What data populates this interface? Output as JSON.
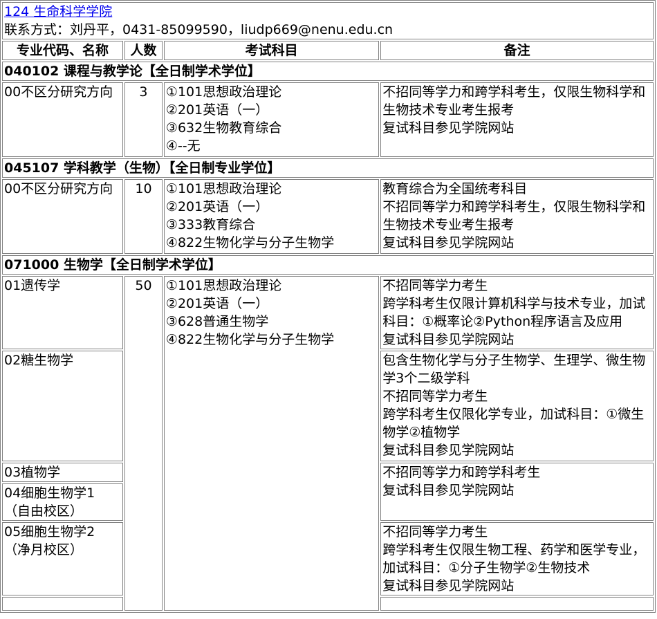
{
  "header": {
    "school_link": "124 生命科学学院",
    "contact": "联系方式：刘丹平，0431-85099590，liudp669@nenu.edu.cn"
  },
  "columns": [
    "专业代码、名称",
    "人数",
    "考试科目",
    "备注"
  ],
  "majors": [
    {
      "title": "040102 课程与教学论【全日制学术学位】",
      "direction": "00不区分研究方向",
      "count": "3",
      "subjects": [
        "①101思想政治理论",
        "②201英语（一）",
        "③632生物教育综合",
        "④--无"
      ],
      "notes": [
        "不招同等学力和跨学科考生，仅限生物科学和生物技术专业考生报考",
        "复试科目参见学院网站"
      ]
    },
    {
      "title": "045107 学科教学（生物）【全日制专业学位】",
      "direction": "00不区分研究方向",
      "count": "10",
      "subjects": [
        "①101思想政治理论",
        "②201英语（一）",
        "③333教育综合",
        "④822生物化学与分子生物学"
      ],
      "notes": [
        "教育综合为全国统考科目",
        "不招同等学力和跨学科考生，仅限生物科学和生物技术专业考生报考",
        "复试科目参见学院网站"
      ]
    },
    {
      "title": "071000 生物学【全日制学术学位】",
      "count": "50",
      "subjects": [
        "①101思想政治理论",
        "②201英语（一）",
        "③628普通生物学",
        "④822生物化学与分子生物学"
      ],
      "directions": [
        {
          "name": "01遗传学",
          "notes": [
            "不招同等学力考生",
            "跨学科考生仅限计算机科学与技术专业，加试科目：①概率论②Python程序语言及应用",
            "复试科目参见学院网站"
          ]
        },
        {
          "name": "02糖生物学",
          "notes": [
            "包含生物化学与分子生物学、生理学、微生物学3个二级学科",
            "不招同等学力考生",
            "跨学科考生仅限化学专业，加试科目：①微生物学②植物学",
            "复试科目参见学院网站"
          ]
        },
        {
          "name": "03植物学",
          "notes": [
            "不招同等学力和跨学科考生",
            "复试科目参见学院网站"
          ]
        },
        {
          "name": "04细胞生物学1（自由校区）"
        },
        {
          "name": "05细胞生物学2（净月校区）",
          "notes": [
            "不招同等学力考生",
            "跨学科考生仅限生物工程、药学和医学专业，加试科目：①分子生物学②生物技术",
            "复试科目参见学院网站"
          ]
        }
      ]
    }
  ]
}
